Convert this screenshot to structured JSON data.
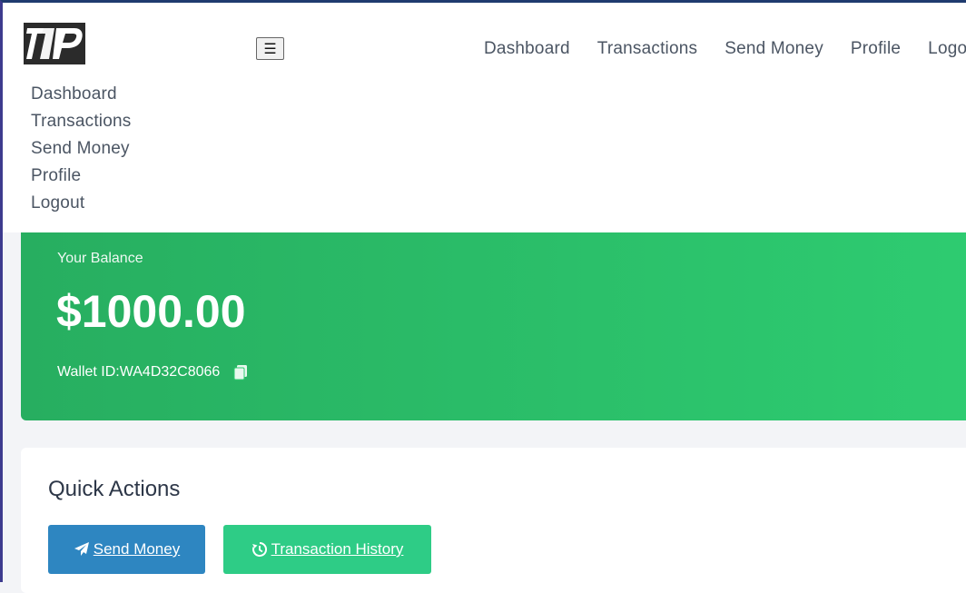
{
  "brand": {
    "logo_alt": "TP logo"
  },
  "header": {
    "menu_toggle_icon": "hamburger-icon",
    "top_nav": [
      {
        "label": "Dashboard"
      },
      {
        "label": "Transactions"
      },
      {
        "label": "Send Money"
      },
      {
        "label": "Profile"
      },
      {
        "label": "Logout"
      }
    ],
    "side_nav": [
      {
        "label": "Dashboard"
      },
      {
        "label": "Transactions"
      },
      {
        "label": "Send Money"
      },
      {
        "label": "Profile"
      },
      {
        "label": "Logout"
      }
    ]
  },
  "balance": {
    "label": "Your Balance",
    "amount": "$1000.00",
    "wallet_text": "Wallet ID:WA4D32C8066",
    "copy_icon": "copy-icon",
    "gradient_from": "#27ae60",
    "gradient_to": "#2ecc71"
  },
  "quick_actions": {
    "title": "Quick Actions",
    "send_label": "Send Money",
    "history_label": "Transaction History",
    "send_color": "#2e86c1",
    "history_color": "#2ecc86"
  }
}
